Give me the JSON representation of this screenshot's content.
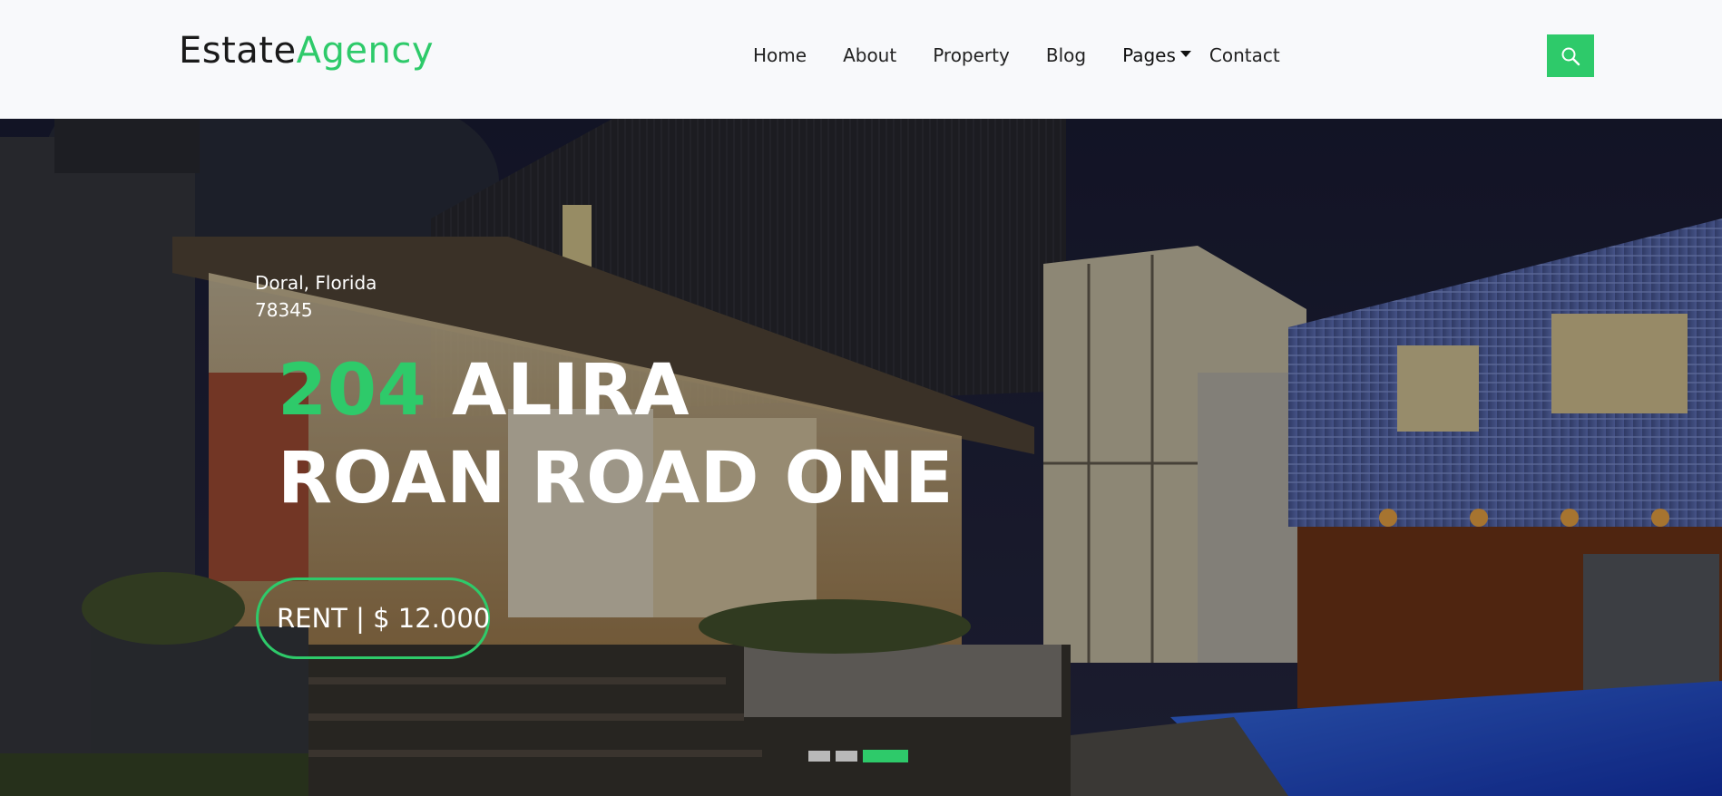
{
  "brand": {
    "part1": "Estate",
    "part2": "Agency"
  },
  "nav": {
    "items": [
      "Home",
      "About",
      "Property",
      "Blog",
      "Pages",
      "Contact"
    ]
  },
  "search": {
    "icon": "search-icon"
  },
  "hero": {
    "location_line1": "Doral, Florida",
    "location_line2": "78345",
    "title_number": "204",
    "title_rest_line1": " ALIRA",
    "title_line2": "ROAN ROAD ONE",
    "price": "RENT | $ 12.000",
    "carousel": {
      "slide_count": 3,
      "active_slide": 3
    }
  },
  "colors": {
    "accent": "#2eca6a",
    "nav_bg": "#f8f9fb",
    "text_dark": "#1a1a1a",
    "text_light": "#ffffff"
  }
}
